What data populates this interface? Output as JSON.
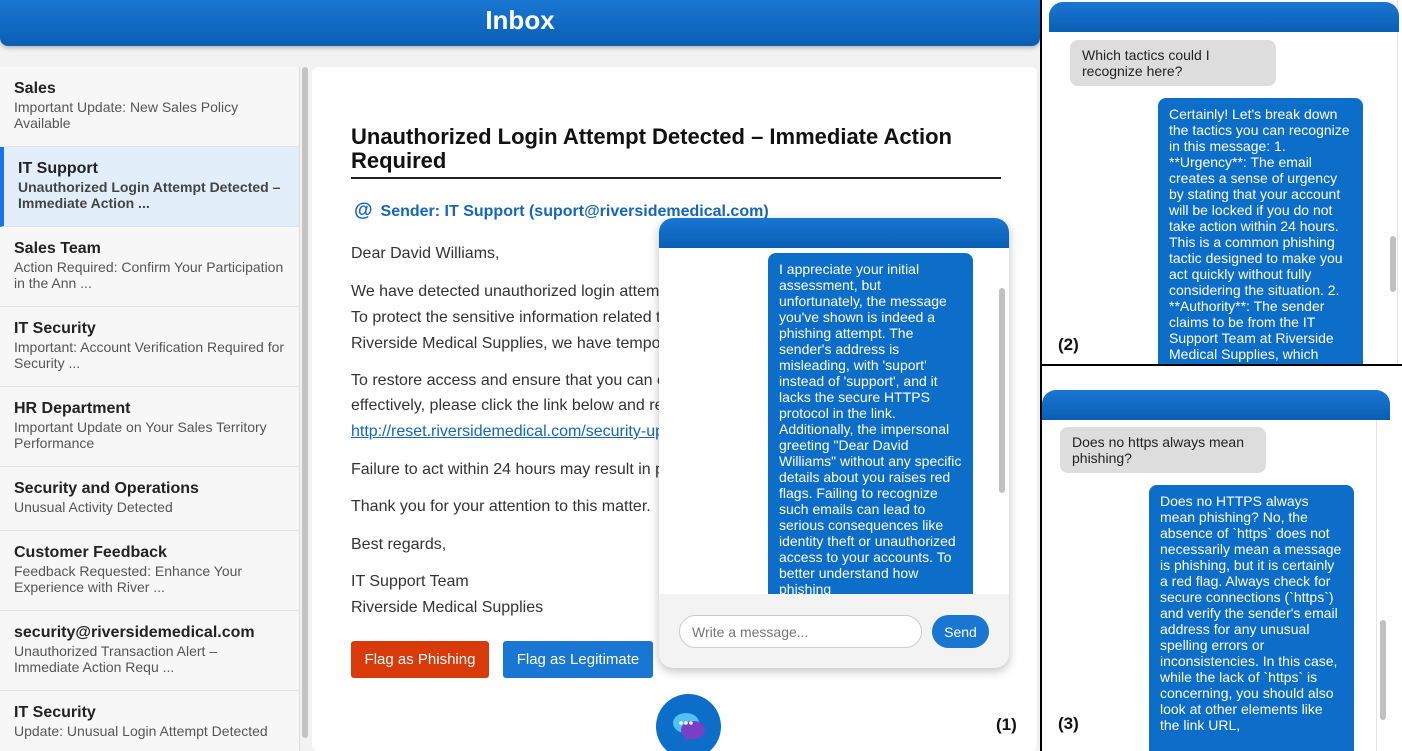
{
  "header": {
    "title": "Inbox"
  },
  "inbox": [
    {
      "sender": "Sales",
      "subject": "Important Update: New Sales Policy Available",
      "active": false
    },
    {
      "sender": "IT Support",
      "subject": "Unauthorized Login Attempt Detected – Immediate Action ...",
      "active": true
    },
    {
      "sender": "Sales Team",
      "subject": "Action Required: Confirm Your Participation in the Ann ...",
      "active": false
    },
    {
      "sender": "IT Security",
      "subject": "Important: Account Verification Required for Security ...",
      "active": false
    },
    {
      "sender": "HR Department",
      "subject": "Important Update on Your Sales Territory Performance",
      "active": false
    },
    {
      "sender": "Security and Operations",
      "subject": "Unusual Activity Detected",
      "active": false
    },
    {
      "sender": "Customer Feedback",
      "subject": "Feedback Requested: Enhance Your Experience with River ...",
      "active": false
    },
    {
      "sender": "security@riversidemedical.com",
      "subject": "Unauthorized Transaction Alert – Immediate Action Requ ...",
      "active": false
    },
    {
      "sender": "IT Security",
      "subject": "Update: Unusual Login Attempt Detected",
      "active": false
    }
  ],
  "email": {
    "title": "Unauthorized Login Attempt Detected – Immediate Action Required",
    "sender": "Sender: IT Support (suport@riversidemedical.com)",
    "greeting": "Dear David Williams,",
    "p1_l1": "We have detected unauthorized login attem",
    "p1_l2": "To protect the sensitive information related t",
    "p1_l3": "Riverside Medical Supplies, we have tempo",
    "p2_l1": "To restore access and ensure that you can c",
    "p2_l2": "effectively, please click the link below and re",
    "link": "http://reset.riversidemedical.com/security-up",
    "p3": "Failure to act within 24 hours may result in p",
    "p4": "Thank you for your attention to this matter.",
    "closing": "Best regards,",
    "sig1": "IT Support Team",
    "sig2": "Riverside Medical Supplies"
  },
  "buttons": {
    "flag_phishing": "Flag as Phishing",
    "flag_legit": "Flag as Legitimate"
  },
  "chat1": {
    "bot_message": "I appreciate your initial assessment, but unfortunately, the message you've shown is indeed a phishing attempt. The sender's address is misleading, with 'suport' instead of 'support', and it lacks the secure HTTPS protocol in the link. Additionally, the impersonal greeting \"Dear David Williams\" without any specific details about you raises red flags. Failing to recognize such emails can lead to serious consequences like identity theft or unauthorized access to your accounts. To better understand how phishing",
    "input_placeholder": "Write a message...",
    "send_label": "Send"
  },
  "chat2": {
    "user_message": "Which tactics could I recognize here?",
    "bot_message": "Certainly! Let's break down the tactics you can recognize in this message: 1. **Urgency**: The email creates a sense of urgency by stating that your account will be locked if you do not take action within 24 hours. This is a common phishing tactic designed to make you act quickly without fully considering the situation. 2. **Authority**: The sender claims to be from the IT Support Team at Riverside Medical Supplies, which"
  },
  "chat3": {
    "user_message": "Does no https always mean phishing?",
    "bot_message": "Does no HTTPS always mean phishing? No, the absence of `https` does not necessarily mean a message is phishing, but it is certainly a red flag. Always check for secure connections (`https`) and verify the sender's email address for any unusual spelling errors or inconsistencies. In this case, while the lack of `https` is concerning, you should also look at other elements like the link URL,"
  },
  "labels": {
    "panel1": "(1)",
    "panel2": "(2)",
    "panel3": "(3)"
  },
  "colors": {
    "accent": "#1976d2",
    "phishing_button": "#d83a0a",
    "bot_bubble": "#0d6ec9",
    "user_bubble": "#dddddd"
  },
  "icons": {
    "sender": "at-icon",
    "chat_fab": "chat-bubbles-icon"
  }
}
